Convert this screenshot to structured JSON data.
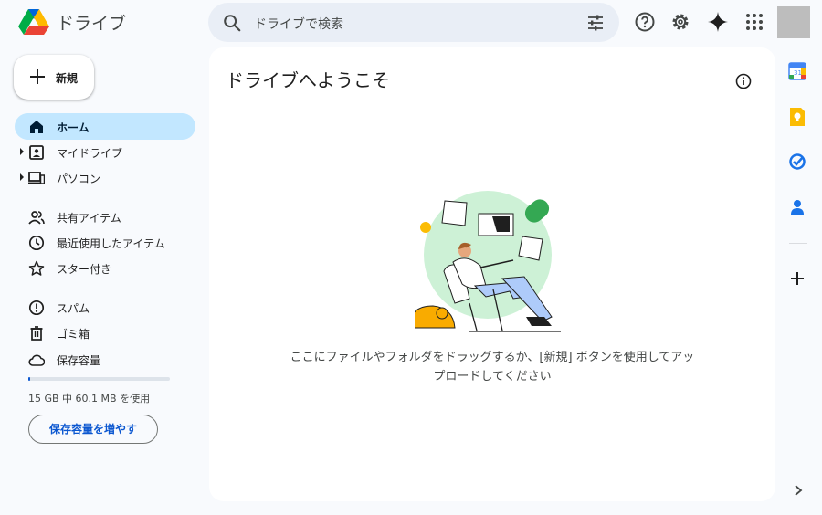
{
  "app": {
    "name": "ドライブ"
  },
  "search": {
    "placeholder": "ドライブで検索"
  },
  "new_button": {
    "label": "新規"
  },
  "sidebar": {
    "items": [
      {
        "label": "ホーム",
        "icon": "home-icon",
        "active": true
      },
      {
        "label": "マイドライブ",
        "icon": "my-drive-icon"
      },
      {
        "label": "パソコン",
        "icon": "computers-icon"
      },
      {
        "label": "共有アイテム",
        "icon": "shared-icon"
      },
      {
        "label": "最近使用したアイテム",
        "icon": "clock-icon"
      },
      {
        "label": "スター付き",
        "icon": "star-icon"
      },
      {
        "label": "スパム",
        "icon": "spam-icon"
      },
      {
        "label": "ゴミ箱",
        "icon": "trash-icon"
      },
      {
        "label": "保存容量",
        "icon": "cloud-icon"
      }
    ],
    "storage": {
      "used_fraction": 0.004,
      "text": "15 GB 中 60.1 MB を使用"
    },
    "upgrade_label": "保存容量を増やす"
  },
  "main": {
    "title": "ドライブへようこそ",
    "empty_text_line1": "ここにファイルやフォルダをドラッグするか、[新規] ボタンを使用してアッ",
    "empty_text_line2": "プロードしてください"
  },
  "colors": {
    "accent": "#0b57d0",
    "active_nav": "#c2e7ff",
    "surface": "#f8fafd",
    "search_bg": "#e9eef6"
  }
}
